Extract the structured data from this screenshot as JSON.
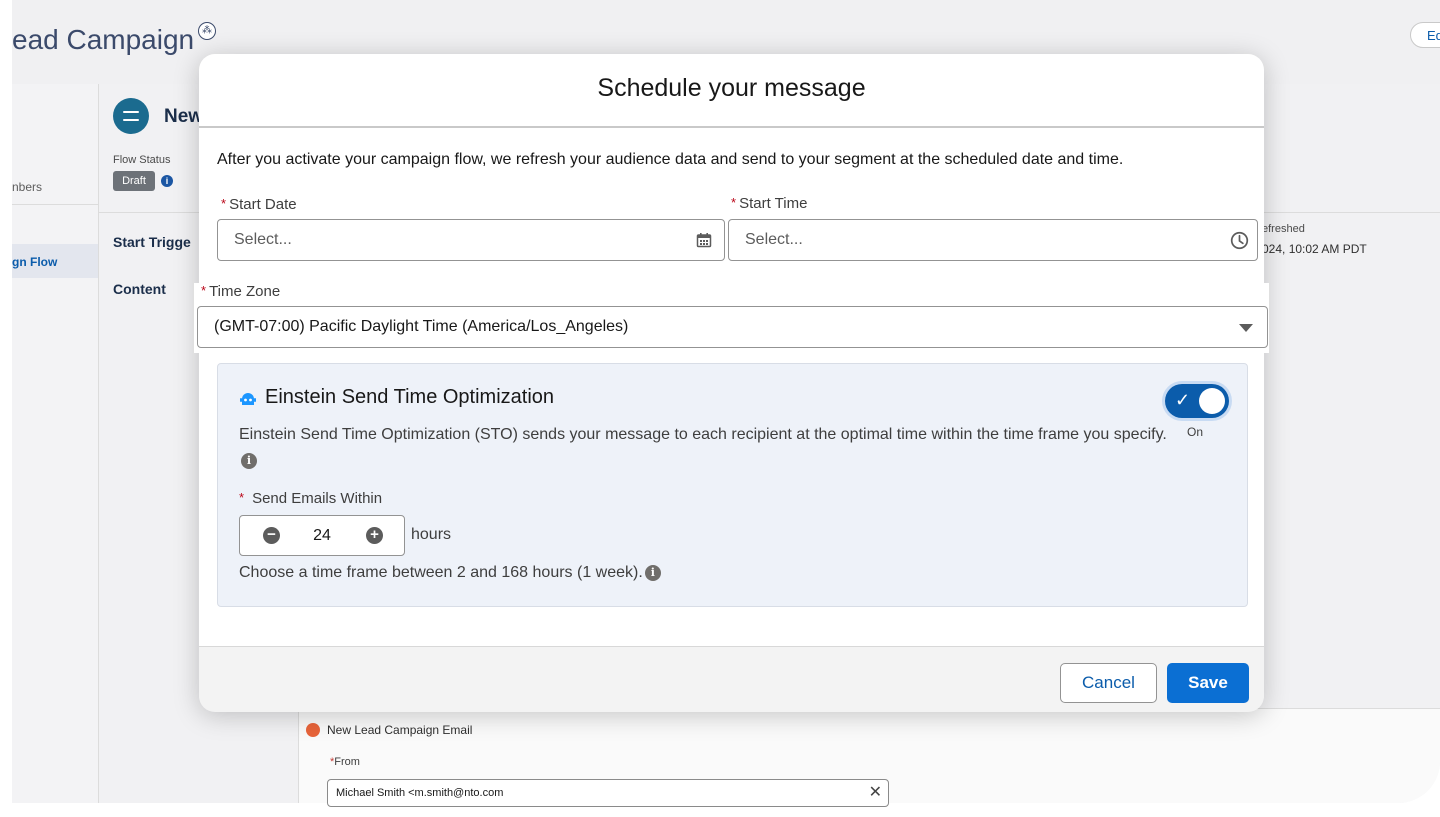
{
  "app": {
    "title": "ead Campaign",
    "edit_label": "Ed"
  },
  "left_rail": {
    "members_label": "nbers",
    "active_item": "gn Flow"
  },
  "flow": {
    "name": "New",
    "status_label": "Flow Status",
    "status_value": "Draft",
    "start_trigger_label": "Start Trigge",
    "content_label": "Content",
    "refreshed_label": "efreshed",
    "refreshed_value": "024, 10:02 AM PDT"
  },
  "email": {
    "title": "New Lead Campaign Email",
    "from_label": "From",
    "from_value": "Michael Smith <m.smith@nto.com"
  },
  "modal": {
    "title": "Schedule your message",
    "description": "After you activate your campaign flow, we refresh your audience data and send to your segment at the scheduled date and time.",
    "start_date": {
      "label": "Start Date",
      "placeholder": "Select..."
    },
    "start_time": {
      "label": "Start Time",
      "placeholder": "Select..."
    },
    "time_zone": {
      "label": "Time Zone",
      "value": "(GMT-07:00) Pacific Daylight Time (America/Los_Angeles)"
    },
    "sto": {
      "title": "Einstein Send Time Optimization",
      "description": "Einstein Send Time Optimization (STO) sends your message to each recipient at the optimal time within the time frame you specify.",
      "toggle_state": "On",
      "send_within_label": "Send Emails Within",
      "send_within_value": "24",
      "unit": "hours",
      "hint": "Choose a time frame between 2 and 168 hours (1 week)."
    },
    "cancel_label": "Cancel",
    "save_label": "Save"
  },
  "colors": {
    "brand_blue": "#0b6fd3",
    "toggle_on": "#0b5cab",
    "required": "#ba0517",
    "sto_panel": "#eef2f9"
  },
  "icons": [
    "calendar-icon",
    "clock-icon",
    "chevron-down-icon",
    "einstein-icon",
    "info-icon",
    "minus-icon",
    "plus-icon",
    "close-icon",
    "checkmark-icon"
  ]
}
